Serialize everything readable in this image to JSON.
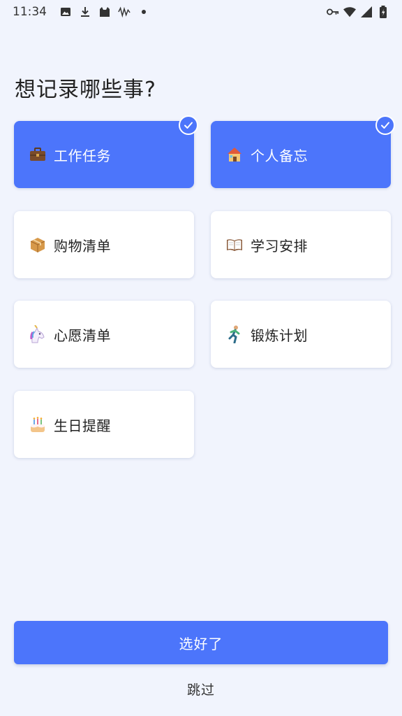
{
  "status_bar": {
    "time": "11:34",
    "left_icons": [
      "image-icon",
      "download-icon",
      "cat-icon",
      "signal-wave-icon",
      "dot-icon"
    ],
    "right_icons": [
      "key-icon",
      "wifi-icon",
      "cell-signal-icon",
      "battery-icon"
    ]
  },
  "page": {
    "title": "想记录哪些事?"
  },
  "categories": [
    {
      "label": "工作任务",
      "icon": "briefcase-icon",
      "selected": true
    },
    {
      "label": "个人备忘",
      "icon": "house-icon",
      "selected": true
    },
    {
      "label": "购物清单",
      "icon": "package-icon",
      "selected": false
    },
    {
      "label": "学习安排",
      "icon": "book-icon",
      "selected": false
    },
    {
      "label": "心愿清单",
      "icon": "unicorn-icon",
      "selected": false
    },
    {
      "label": "锻炼计划",
      "icon": "runner-icon",
      "selected": false
    },
    {
      "label": "生日提醒",
      "icon": "birthday-cake-icon",
      "selected": false
    }
  ],
  "actions": {
    "confirm_label": "选好了",
    "skip_label": "跳过"
  },
  "colors": {
    "accent": "#4c75fb",
    "background": "#f1f4fd",
    "card": "#ffffff"
  }
}
